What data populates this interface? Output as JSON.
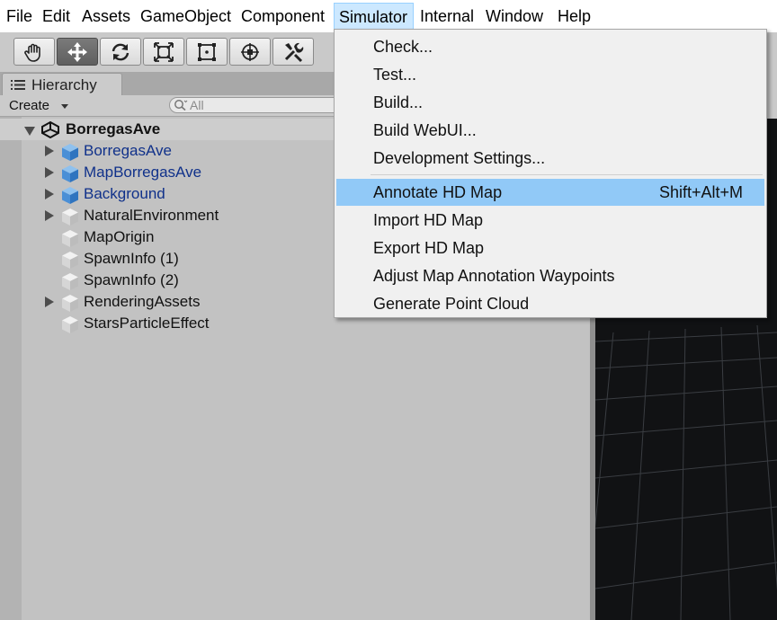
{
  "menubar": {
    "items": [
      "File",
      "Edit",
      "Assets",
      "GameObject",
      "Component",
      "Simulator",
      "Internal",
      "Window",
      "Help"
    ],
    "active_index": 5
  },
  "toolbar": {
    "tools": [
      {
        "icon": "hand-icon"
      },
      {
        "icon": "move-icon",
        "active": true
      },
      {
        "icon": "rotate-icon"
      },
      {
        "icon": "scale-icon"
      },
      {
        "icon": "rect-icon"
      },
      {
        "icon": "transform-icon"
      },
      {
        "icon": "custom-tool-icon"
      }
    ]
  },
  "hierarchy": {
    "tab_label": "Hierarchy",
    "create_label": "Create",
    "search_placeholder": "All",
    "scene_name": "BorregasAve",
    "items": [
      {
        "label": "BorregasAve",
        "expandable": true,
        "prefab": true
      },
      {
        "label": "MapBorregasAve",
        "expandable": true,
        "prefab": true
      },
      {
        "label": "Background",
        "expandable": true,
        "prefab": true
      },
      {
        "label": "NaturalEnvironment",
        "expandable": true,
        "prefab": false
      },
      {
        "label": "MapOrigin",
        "expandable": false,
        "prefab": false
      },
      {
        "label": "SpawnInfo (1)",
        "expandable": false,
        "prefab": false
      },
      {
        "label": "SpawnInfo (2)",
        "expandable": false,
        "prefab": false
      },
      {
        "label": "RenderingAssets",
        "expandable": true,
        "prefab": false
      },
      {
        "label": "StarsParticleEffect",
        "expandable": false,
        "prefab": false
      }
    ]
  },
  "simulator_menu": {
    "group1": [
      "Check...",
      "Test...",
      "Build...",
      "Build WebUI...",
      "Development Settings..."
    ],
    "group2": [
      {
        "label": "Annotate HD Map",
        "shortcut": "Shift+Alt+M",
        "highlighted": true
      },
      {
        "label": "Import HD Map"
      },
      {
        "label": "Export HD Map"
      },
      {
        "label": "Adjust Map Annotation Waypoints"
      },
      {
        "label": "Generate Point Cloud"
      }
    ]
  },
  "colors": {
    "menu_active_bg": "#cce8ff",
    "menu_highlight": "#91c9f7",
    "prefab_text": "#10318a",
    "scene_bg": "#111214"
  }
}
